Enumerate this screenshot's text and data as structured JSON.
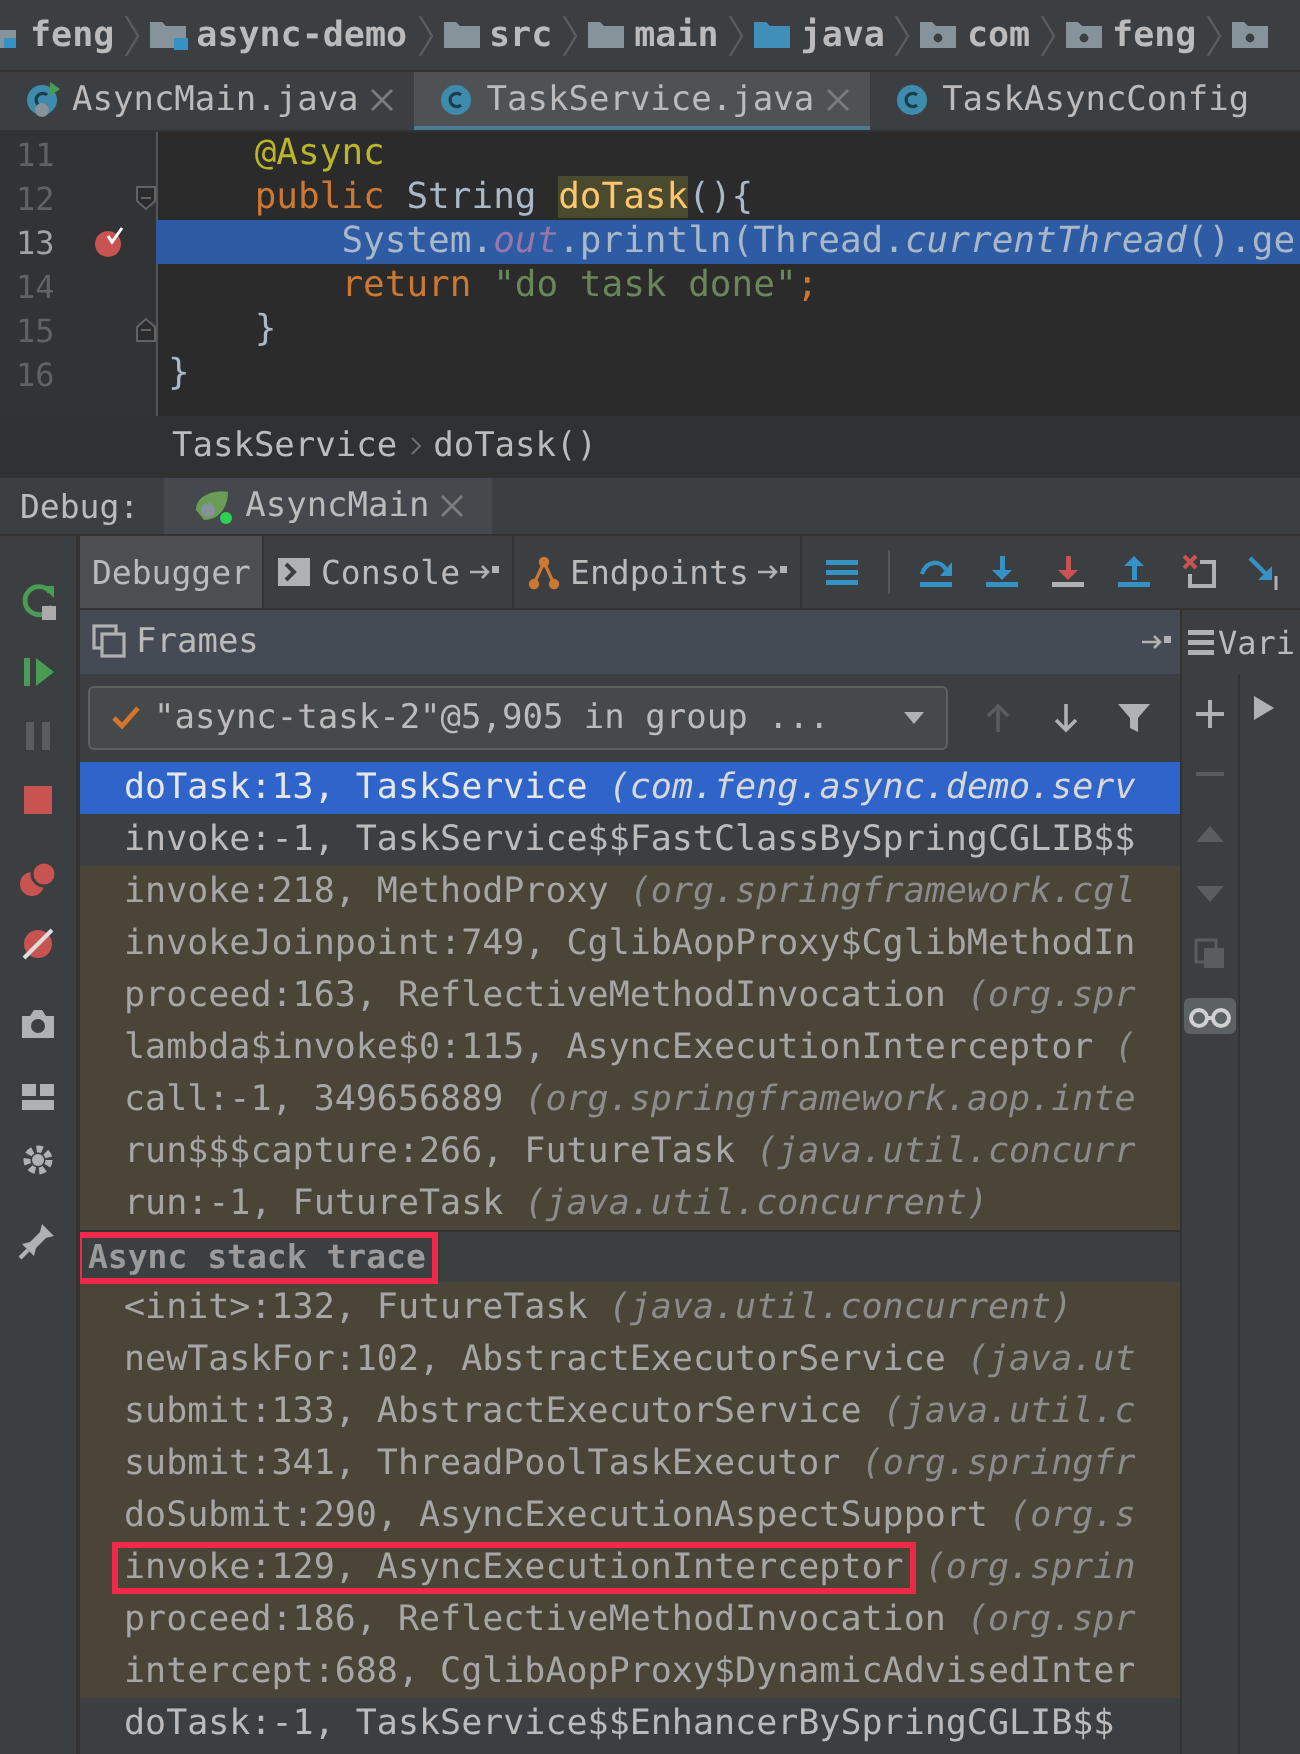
{
  "breadcrumbs": [
    {
      "label": "feng",
      "kind": "project"
    },
    {
      "label": "async-demo",
      "kind": "module"
    },
    {
      "label": "src",
      "kind": "folder"
    },
    {
      "label": "main",
      "kind": "folder"
    },
    {
      "label": "java",
      "kind": "source-root"
    },
    {
      "label": "com",
      "kind": "package"
    },
    {
      "label": "feng",
      "kind": "package"
    },
    {
      "kind": "package"
    }
  ],
  "editor_tabs": [
    {
      "label": "AsyncMain.java",
      "kind": "main-class",
      "selected": false,
      "closable": true
    },
    {
      "label": "TaskService.java",
      "kind": "class",
      "selected": true,
      "closable": true
    },
    {
      "label": "TaskAsyncConfig",
      "kind": "class",
      "selected": false,
      "closable": false
    }
  ],
  "code_lines": [
    {
      "number": "11",
      "current": false,
      "breakpoint": false,
      "fold_start": false,
      "fold_end": false,
      "tokens": [
        {
          "text": "    @Async",
          "kind": "annotation"
        }
      ]
    },
    {
      "number": "12",
      "current": false,
      "breakpoint": false,
      "fold_start": true,
      "fold_end": false,
      "tokens": [
        {
          "text": "    public ",
          "kind": "keyword"
        },
        {
          "text": "String ",
          "kind": "plain"
        },
        {
          "text": "doTask",
          "kind": "method-decl"
        },
        {
          "text": "(){",
          "kind": "plain"
        }
      ]
    },
    {
      "number": "13",
      "current": true,
      "breakpoint": true,
      "fold_start": false,
      "fold_end": false,
      "tokens": [
        {
          "text": "        System.",
          "kind": "plain"
        },
        {
          "text": "out",
          "kind": "static-field"
        },
        {
          "text": ".println(Thread.",
          "kind": "plain"
        },
        {
          "text": "currentThread",
          "kind": "static-method"
        },
        {
          "text": "().ge",
          "kind": "plain"
        }
      ]
    },
    {
      "number": "14",
      "current": false,
      "breakpoint": false,
      "fold_start": false,
      "fold_end": false,
      "tokens": [
        {
          "text": "        return ",
          "kind": "keyword"
        },
        {
          "text": "\"do task done\"",
          "kind": "string"
        },
        {
          "text": ";",
          "kind": "keyword"
        }
      ]
    },
    {
      "number": "15",
      "current": false,
      "breakpoint": false,
      "fold_start": false,
      "fold_end": true,
      "tokens": [
        {
          "text": "    }",
          "kind": "plain"
        }
      ]
    },
    {
      "number": "16",
      "current": false,
      "breakpoint": false,
      "fold_start": false,
      "fold_end": false,
      "tokens": [
        {
          "text": "}",
          "kind": "plain"
        }
      ]
    }
  ],
  "editor_breadcrumb": [
    "TaskService",
    "doTask()"
  ],
  "debug": {
    "label": "Debug:",
    "session_tab": {
      "label": "AsyncMain",
      "selected": true
    }
  },
  "debug_tabs": [
    {
      "label": "Debugger",
      "kind": "debugger",
      "selected": true,
      "pinnable": false
    },
    {
      "label": "Console",
      "kind": "console",
      "selected": false,
      "pinnable": true
    },
    {
      "label": "Endpoints",
      "kind": "endpoints",
      "selected": false,
      "pinnable": true
    }
  ],
  "frames_panel": {
    "title": "Frames"
  },
  "variables_panel": {
    "title": "Vari"
  },
  "thread": {
    "value": "\"async-task-2\"@5,905 in group ..."
  },
  "frames": [
    {
      "kind": "frame",
      "method": "doTask:13, TaskService",
      "location": "(com.feng.async.demo.serv",
      "selected": true,
      "library": false,
      "marked": false
    },
    {
      "kind": "frame",
      "method": "invoke:-1, TaskService$$FastClassBySpringCGLIB$$",
      "selected": false,
      "library": false,
      "marked": false
    },
    {
      "kind": "frame",
      "method": "invoke:218, MethodProxy",
      "location": "(org.springframework.cgl",
      "selected": false,
      "library": true,
      "marked": false
    },
    {
      "kind": "frame",
      "method": "invokeJoinpoint:749, CglibAopProxy$CglibMethodIn",
      "selected": false,
      "library": true,
      "marked": false
    },
    {
      "kind": "frame",
      "method": "proceed:163, ReflectiveMethodInvocation",
      "location": "(org.spr",
      "selected": false,
      "library": true,
      "marked": false
    },
    {
      "kind": "frame",
      "method": "lambda$invoke$0:115, AsyncExecutionInterceptor",
      "location": "(",
      "selected": false,
      "library": true,
      "marked": false
    },
    {
      "kind": "frame",
      "method": "call:-1, 349656889",
      "location": "(org.springframework.aop.inte",
      "selected": false,
      "library": true,
      "marked": false
    },
    {
      "kind": "frame",
      "method": "run$$$capture:266, FutureTask",
      "location": "(java.util.concurr",
      "selected": false,
      "library": true,
      "marked": false
    },
    {
      "kind": "frame",
      "method": "run:-1, FutureTask",
      "location": "(java.util.concurrent)",
      "selected": false,
      "library": true,
      "marked": false
    },
    {
      "kind": "separator",
      "label": "Async stack trace",
      "marked": true
    },
    {
      "kind": "frame",
      "method": "<init>:132, FutureTask",
      "location": "(java.util.concurrent)",
      "selected": false,
      "library": true,
      "marked": false
    },
    {
      "kind": "frame",
      "method": "newTaskFor:102, AbstractExecutorService",
      "location": "(java.ut",
      "selected": false,
      "library": true,
      "marked": false
    },
    {
      "kind": "frame",
      "method": "submit:133, AbstractExecutorService",
      "location": "(java.util.c",
      "selected": false,
      "library": true,
      "marked": false
    },
    {
      "kind": "frame",
      "method": "submit:341, ThreadPoolTaskExecutor",
      "location": "(org.springfr",
      "selected": false,
      "library": true,
      "marked": false
    },
    {
      "kind": "frame",
      "method": "doSubmit:290, AsyncExecutionAspectSupport",
      "location": "(org.s",
      "selected": false,
      "library": true,
      "marked": false
    },
    {
      "kind": "frame",
      "method": "invoke:129, AsyncExecutionInterceptor",
      "location": "(org.sprin",
      "selected": false,
      "library": true,
      "marked": true
    },
    {
      "kind": "frame",
      "method": "proceed:186, ReflectiveMethodInvocation",
      "location": "(org.spr",
      "selected": false,
      "library": true,
      "marked": false
    },
    {
      "kind": "frame",
      "method": "intercept:688, CglibAopProxy$DynamicAdvisedInter",
      "selected": false,
      "library": true,
      "marked": false
    },
    {
      "kind": "frame",
      "method": "doTask:-1, TaskService$$EnhancerBySpringCGLIB$$",
      "selected": false,
      "library": false,
      "marked": false
    }
  ]
}
